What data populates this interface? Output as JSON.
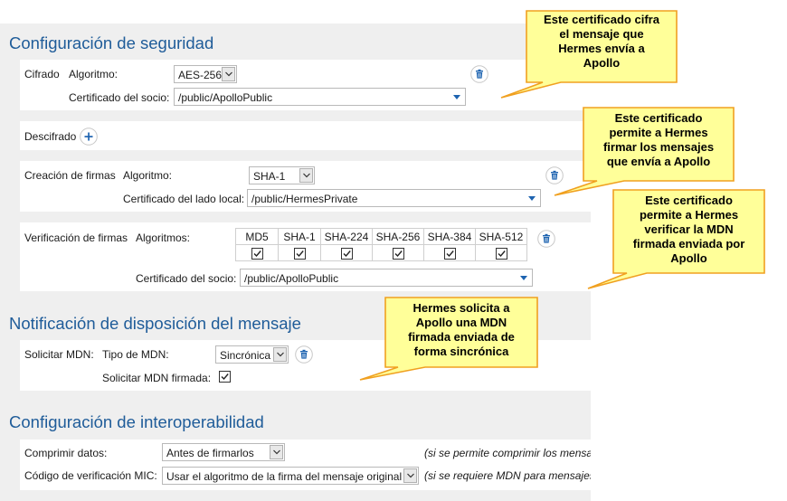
{
  "security": {
    "title": "Configuración de seguridad",
    "cifrado": {
      "label": "Cifrado",
      "algorithm_label": "Algoritmo:",
      "algorithm_value": "AES-256",
      "cert_label": "Certificado del socio:",
      "cert_value": "/public/ApolloPublic"
    },
    "descifrado": {
      "label": "Descifrado"
    },
    "firmas": {
      "label": "Creación de firmas",
      "algorithm_label": "Algoritmo:",
      "algorithm_value": "SHA-1",
      "cert_label": "Certificado del lado local:",
      "cert_value": "/public/HermesPrivate"
    },
    "verificacion": {
      "label": "Verificación de firmas",
      "algorithms_label": "Algoritmos:",
      "hashes": [
        {
          "name": "MD5",
          "checked": true
        },
        {
          "name": "SHA-1",
          "checked": true
        },
        {
          "name": "SHA-224",
          "checked": true
        },
        {
          "name": "SHA-256",
          "checked": true
        },
        {
          "name": "SHA-384",
          "checked": true
        },
        {
          "name": "SHA-512",
          "checked": true
        }
      ],
      "cert_label": "Certificado del socio:",
      "cert_value": "/public/ApolloPublic"
    }
  },
  "mdn": {
    "title": "Notificación de disposición del mensaje",
    "request_label": "Solicitar MDN:",
    "type_label": "Tipo de MDN:",
    "type_value": "Sincrónica",
    "signed_label": "Solicitar MDN firmada:",
    "signed_checked": true
  },
  "interop": {
    "title": "Configuración de interoperabilidad",
    "compress_label": "Comprimir datos:",
    "compress_value": "Antes de firmarlos",
    "compress_note": "(si se permite comprimir los mensaje",
    "mic_label": "Código de verificación MIC:",
    "mic_value": "Usar el algoritmo de la firma del mensaje original",
    "mic_note": "(si se requiere MDN para mensajes"
  },
  "callouts": [
    {
      "lines": [
        "Este certificado cifra",
        "el mensaje que",
        "Hermes envía a",
        "Apollo"
      ]
    },
    {
      "lines": [
        "Este certificado",
        "permite a Hermes",
        "firmar los mensajes",
        "que envía a Apollo"
      ]
    },
    {
      "lines": [
        "Este certificado",
        "permite a Hermes",
        "verificar la MDN",
        "firmada enviada por",
        "Apollo"
      ]
    },
    {
      "lines": [
        "Hermes solicita a",
        "Apollo una MDN",
        "firmada enviada de",
        "forma sincrónica"
      ]
    }
  ],
  "colors": {
    "heading": "#1f5c99",
    "callout_fill": "#ffff99",
    "callout_border": "#f0a020",
    "accent": "#1d63b0"
  }
}
